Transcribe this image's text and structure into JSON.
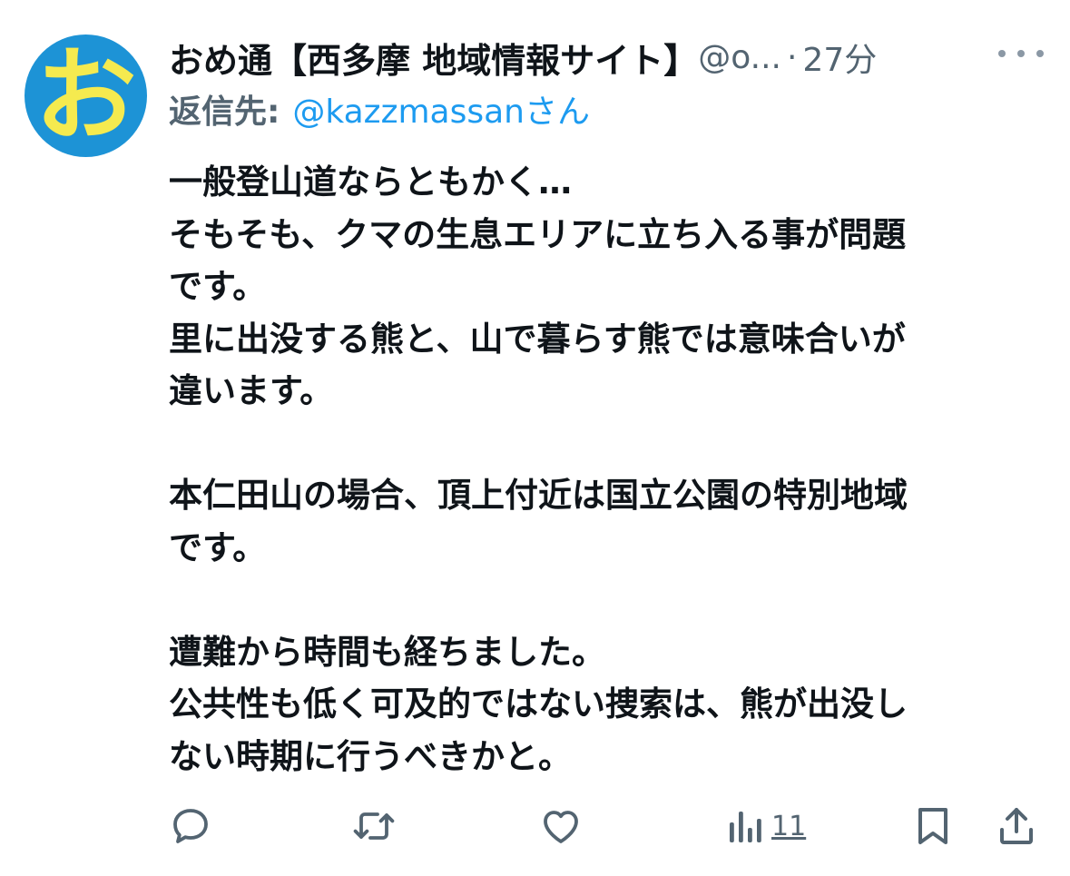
{
  "tweet": {
    "author_name": "おめ通【西多摩 地域情報サイト】",
    "handle": "@o...",
    "separator": "·",
    "time": "27分",
    "avatar_glyph": "お",
    "avatar_bg": "#1d93d6",
    "avatar_fg": "#f5ea4f",
    "reply_label": "返信先:",
    "reply_user": "@kazzmassanさん",
    "body_lines": [
      "一般登山道ならともかく…",
      "そもそも、クマの生息エリアに立ち入る事が問題",
      "です。",
      "里に出没する熊と、山で暮らす熊では意味合いが",
      "違います。",
      "",
      "本仁田山の場合、頂上付近は国立公園の特別地域",
      "です。",
      "",
      "遭難から時間も経ちました。",
      "公共性も低く可及的ではない捜索は、熊が出没し",
      "ない時期に行うべきかと。"
    ],
    "views_count": "11"
  },
  "icons": {
    "reply": "reply-icon",
    "retweet": "retweet-icon",
    "like": "heart-icon",
    "views": "views-icon",
    "bookmark": "bookmark-icon",
    "share": "share-icon",
    "more": "more-icon"
  },
  "colors": {
    "text": "#0f1419",
    "secondary": "#536471",
    "link": "#1d9bf0"
  }
}
